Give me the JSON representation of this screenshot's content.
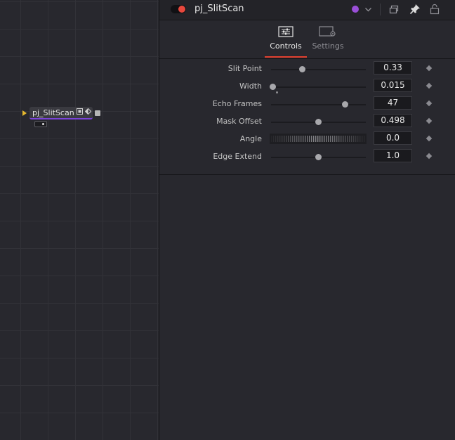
{
  "node_graph": {
    "node": {
      "label": "pj_SlitScan",
      "color": "#7b44d9"
    }
  },
  "inspector": {
    "header": {
      "tool_name": "pj_SlitScan",
      "tool_color": "#9a4fd8",
      "power_state": "on",
      "icons": [
        "power-toggle-icon",
        "color-dot-icon",
        "chevron-down-icon",
        "versions-icon",
        "pin-icon",
        "lock-icon"
      ]
    },
    "tabs": [
      {
        "label": "Controls",
        "icon": "sliders-icon",
        "active": true
      },
      {
        "label": "Settings",
        "icon": "settings-icon",
        "active": false
      }
    ],
    "controls": [
      {
        "label": "Slit Point",
        "value": "0.33",
        "slider_fraction": 0.33
      },
      {
        "label": "Width",
        "value": "0.015",
        "slider_fraction": 0.015
      },
      {
        "label": "Echo Frames",
        "value": "47",
        "slider_fraction": 0.78
      },
      {
        "label": "Mask Offset",
        "value": "0.498",
        "slider_fraction": 0.498
      },
      {
        "label": "Angle",
        "value": "0.0"
      },
      {
        "label": "Edge Extend",
        "value": "1.0",
        "slider_fraction": 0.5
      }
    ],
    "accent_color": "#e0402f"
  }
}
